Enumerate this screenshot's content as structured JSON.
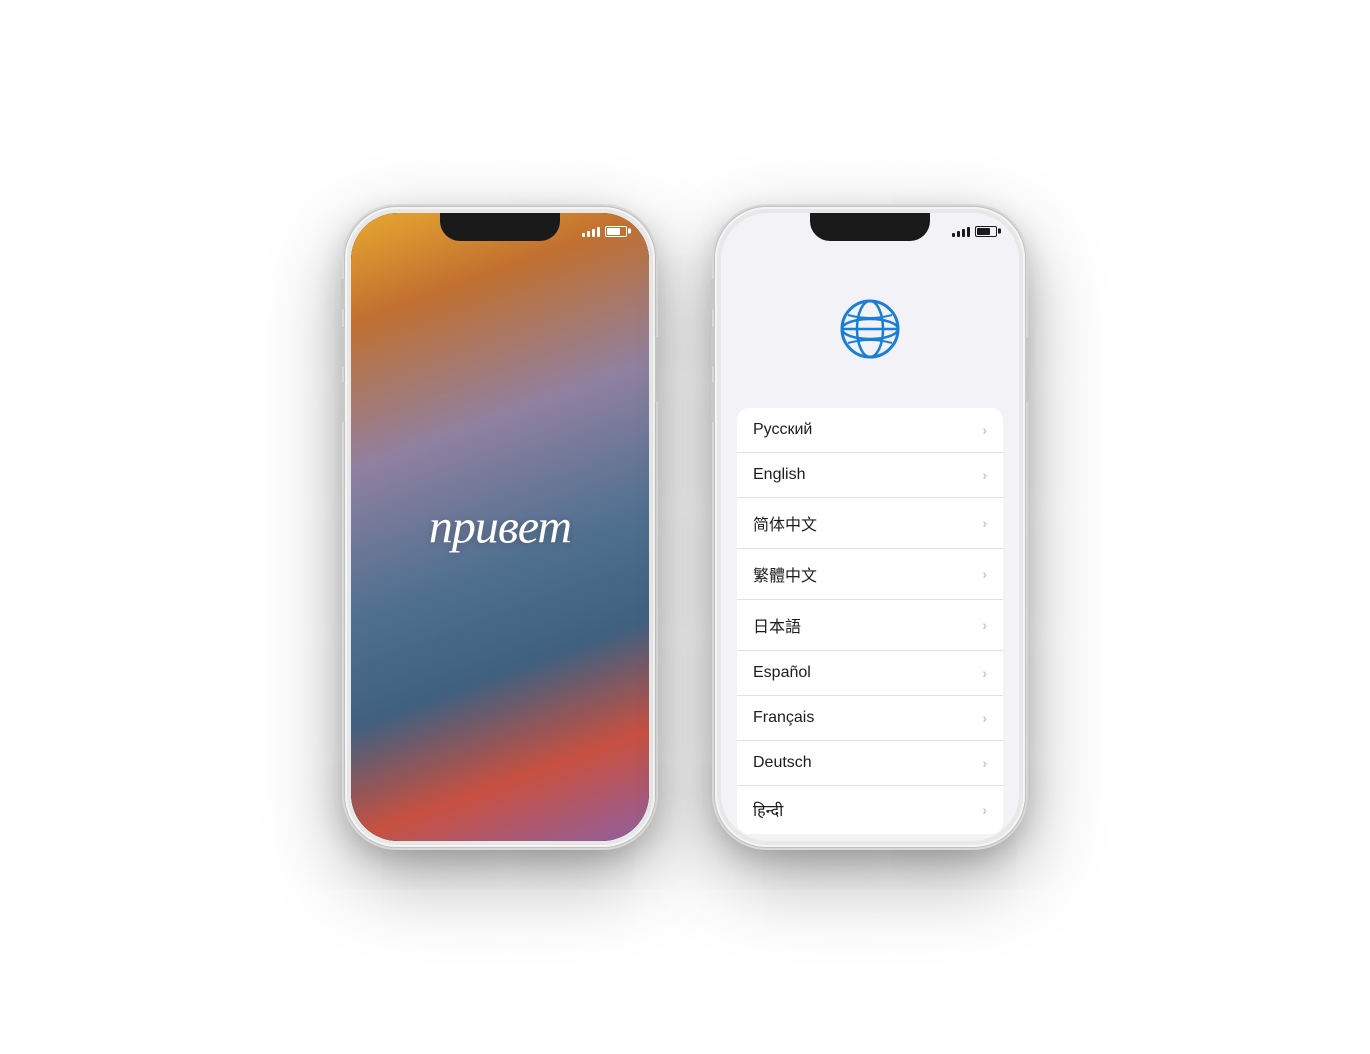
{
  "phone1": {
    "greeting": "привет",
    "status": {
      "signal_color": "white",
      "battery_color": "white"
    }
  },
  "phone2": {
    "globe_icon_color": "#1a7fd4",
    "status": {
      "signal_color": "#1c1c1e",
      "battery_color": "#1c1c1e"
    },
    "languages": [
      {
        "label": "Русский",
        "id": "russian"
      },
      {
        "label": "English",
        "id": "english"
      },
      {
        "label": "简体中文",
        "id": "simplified-chinese"
      },
      {
        "label": "繁體中文",
        "id": "traditional-chinese"
      },
      {
        "label": "日本語",
        "id": "japanese"
      },
      {
        "label": "Español",
        "id": "spanish"
      },
      {
        "label": "Français",
        "id": "french"
      },
      {
        "label": "Deutsch",
        "id": "german"
      },
      {
        "label": "हिन्दी",
        "id": "hindi"
      }
    ]
  }
}
